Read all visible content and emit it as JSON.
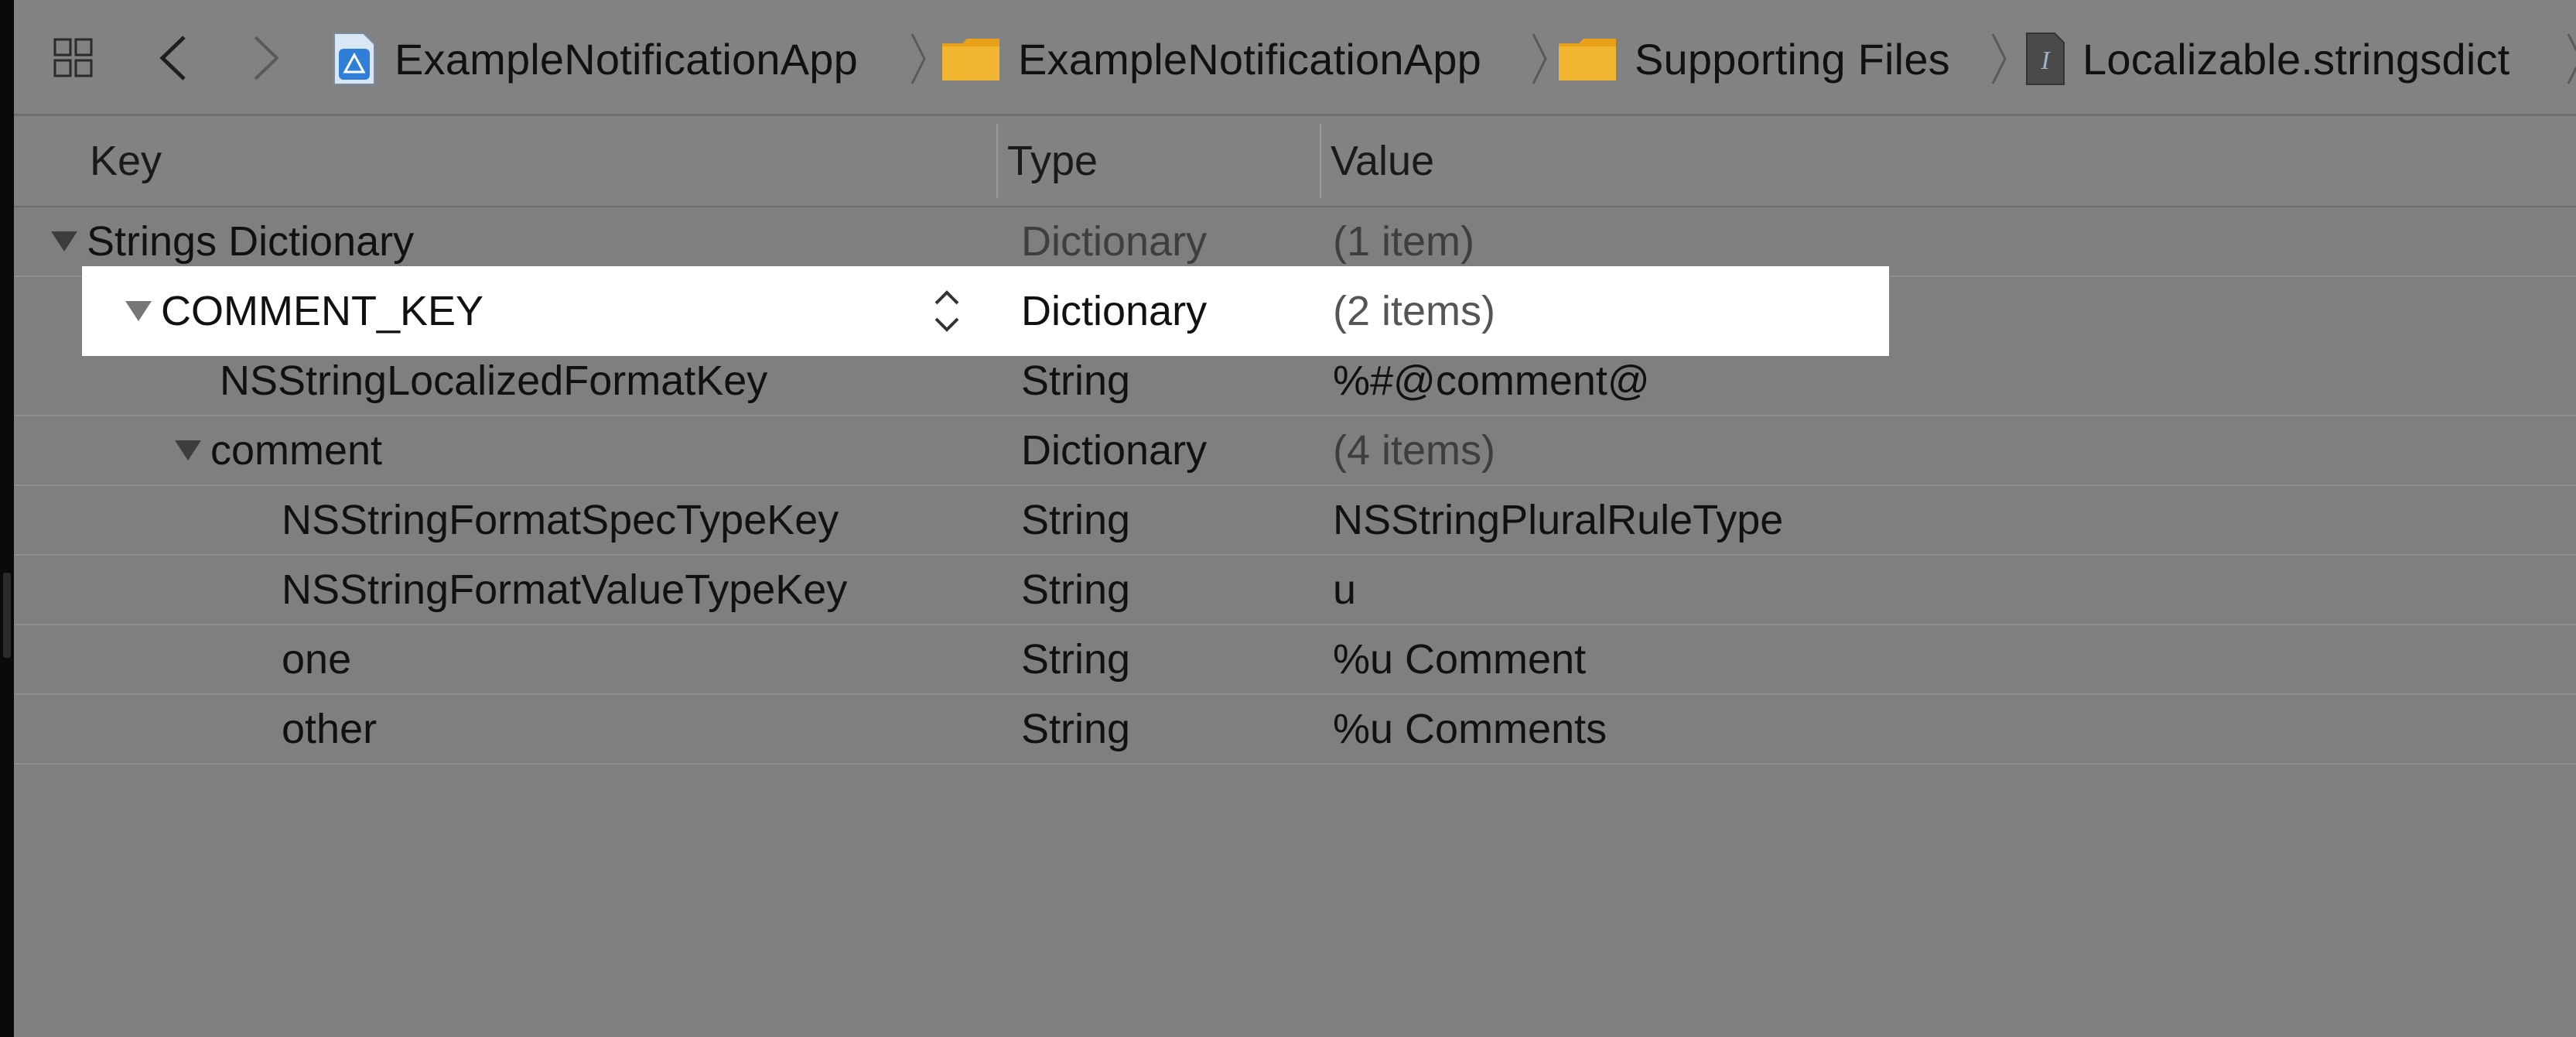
{
  "jumpbar": {
    "breadcrumbs": [
      {
        "label": "ExampleNotificationApp",
        "icon": "project-file-icon"
      },
      {
        "label": "ExampleNotificationApp",
        "icon": "folder-icon"
      },
      {
        "label": "Supporting Files",
        "icon": "folder-icon"
      },
      {
        "label": "Localizable.stringsdict",
        "icon": "strings-file-icon"
      }
    ]
  },
  "columns": {
    "key": "Key",
    "type": "Type",
    "value": "Value"
  },
  "rows": [
    {
      "key": "Strings Dictionary",
      "type": "Dictionary",
      "value": "(1 item)",
      "expandable": true
    },
    {
      "key": "COMMENT_KEY",
      "type": "Dictionary",
      "value": "(2 items)",
      "expandable": true,
      "selected": true
    },
    {
      "key": "NSStringLocalizedFormatKey",
      "type": "String",
      "value": "%#@comment@",
      "expandable": false
    },
    {
      "key": "comment",
      "type": "Dictionary",
      "value": "(4 items)",
      "expandable": true
    },
    {
      "key": "NSStringFormatSpecTypeKey",
      "type": "String",
      "value": "NSStringPluralRuleType",
      "expandable": false
    },
    {
      "key": "NSStringFormatValueTypeKey",
      "type": "String",
      "value": "u",
      "expandable": false
    },
    {
      "key": "one",
      "type": "String",
      "value": "%u Comment",
      "expandable": false
    },
    {
      "key": "other",
      "type": "String",
      "value": "%u Comments",
      "expandable": false
    }
  ],
  "colors": {
    "background": "#7f7f7f",
    "selection": "#ffffff",
    "folder": "#e8a21a",
    "project": "#2f7fd8"
  }
}
